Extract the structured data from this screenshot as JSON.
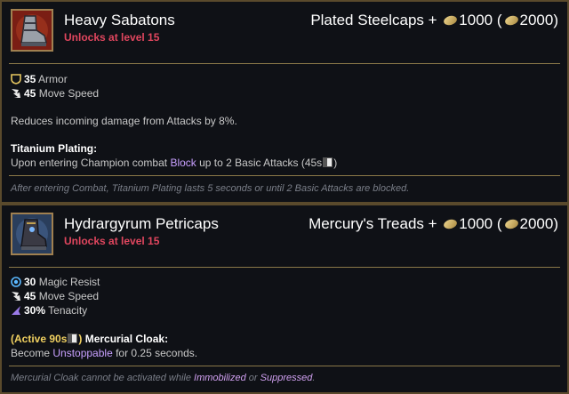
{
  "items": [
    {
      "name": "Heavy Sabatons",
      "unlock": "Unlocks at level 15",
      "upgrade_name": "Plated Steelcaps + ",
      "cost": "1000",
      "total_open": " (",
      "total": "2000",
      "total_close": ")",
      "icon": "boots-icon",
      "stats": [
        {
          "value": "35",
          "label": " Armor",
          "icon": "armor-icon"
        },
        {
          "value": "45",
          "label": " Move Speed",
          "icon": "move-speed-icon"
        }
      ],
      "description": "Reduces incoming damage from Attacks by 8%.",
      "passive_name": "Titanium Plating:",
      "passive_text_1": "Upon entering Champion combat ",
      "passive_kw": "Block",
      "passive_text_2": " up to 2 Basic Attacks (45s",
      "passive_text_3": ")",
      "note": "After entering Combat, Titanium Plating lasts 5 seconds or until 2 Basic Attacks are blocked."
    },
    {
      "name": "Hydrargyrum Petricaps",
      "unlock": "Unlocks at level 15",
      "upgrade_name": "Mercury's Treads + ",
      "cost": "1000",
      "total_open": " (",
      "total": "2000",
      "total_close": ")",
      "icon": "boots-icon",
      "stats": [
        {
          "value": "30",
          "label": " Magic Resist",
          "icon": "magic-resist-icon"
        },
        {
          "value": "45",
          "label": " Move Speed",
          "icon": "move-speed-icon"
        },
        {
          "value": "30%",
          "label": " Tenacity",
          "icon": "tenacity-icon"
        }
      ],
      "active_open": "(Active 90s",
      "active_close": ")",
      "active_name": " Mercurial Cloak:",
      "active_text_1": "Become ",
      "active_kw": "Unstoppable",
      "active_text_2": " for 0.25 seconds.",
      "note_1": "Mercurial Cloak cannot be activated while ",
      "note_kw1": "Immobilized",
      "note_2": " or ",
      "note_kw2": "Suppressed",
      "note_3": "."
    }
  ],
  "colors": {
    "unlock": "#e0465e",
    "keyword": "#c8a0ff",
    "active": "#f0d060",
    "border": "#5a4a2c"
  }
}
